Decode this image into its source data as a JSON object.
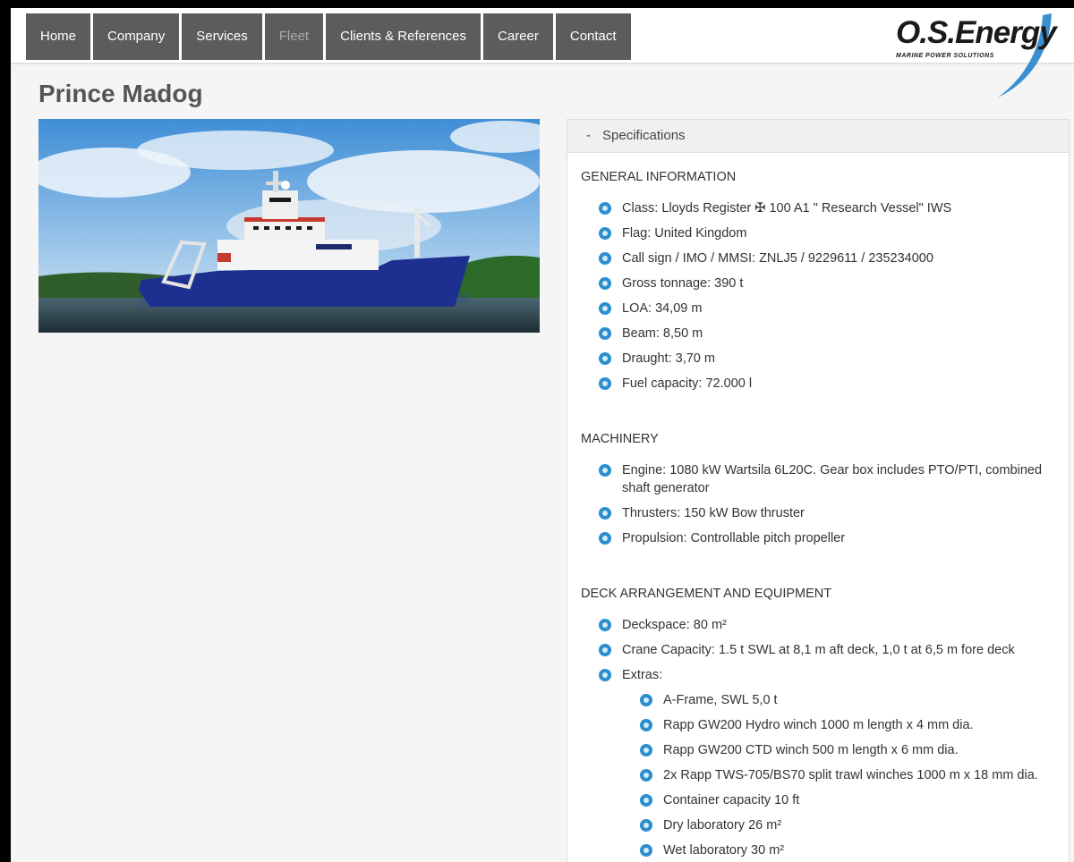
{
  "nav": {
    "items": [
      {
        "label": "Home"
      },
      {
        "label": "Company"
      },
      {
        "label": "Services"
      },
      {
        "label": "Fleet"
      },
      {
        "label": "Clients & References"
      },
      {
        "label": "Career"
      },
      {
        "label": "Contact"
      }
    ]
  },
  "logo": {
    "name": "O.S.Energy",
    "tagline": "MARINE POWER SOLUTIONS",
    "accent_color": "#3b8fd0"
  },
  "page": {
    "title": "Prince Madog"
  },
  "photo": {
    "icon": "ship-photo"
  },
  "specs": {
    "header": "Specifications",
    "toggle": "-",
    "sections": {
      "general": {
        "title": "GENERAL INFORMATION",
        "items": [
          "Class: Lloyds Register ✠ 100 A1 \" Research Vessel\" IWS",
          "Flag: United Kingdom",
          "Call sign / IMO / MMSI: ZNLJ5 / 9229611 / 235234000",
          "Gross tonnage: 390 t",
          "LOA: 34,09 m",
          "Beam: 8,50 m",
          "Draught: 3,70 m",
          "Fuel capacity: 72.000 l"
        ]
      },
      "machinery": {
        "title": "MACHINERY",
        "items": [
          "Engine: 1080 kW Wartsila 6L20C. Gear box includes PTO/PTI, combined shaft generator",
          "Thrusters: 150 kW Bow thruster",
          "Propulsion: Controllable pitch propeller"
        ]
      },
      "deck": {
        "title": "DECK ARRANGEMENT AND EQUIPMENT",
        "items": [
          "Deckspace: 80 m²",
          "Crane Capacity: 1.5 t SWL at 8,1 m aft deck, 1,0 t at 6,5 m fore deck",
          "Extras:"
        ],
        "extras": [
          "A-Frame, SWL 5,0 t",
          "Rapp GW200 Hydro winch 1000 m length x 4 mm dia.",
          "Rapp GW200 CTD winch 500 m length x 6 mm dia.",
          "2x Rapp TWS-705/BS70 split trawl winches 1000 m x 18 mm dia.",
          "Container capacity 10 ft",
          "Dry laboratory 26 m²",
          "Wet laboratory 30 m²"
        ]
      }
    }
  },
  "colors": {
    "nav_bg": "#5c5c5c",
    "bullet": "#2b8ecf",
    "hull": "#1d2f8f"
  }
}
